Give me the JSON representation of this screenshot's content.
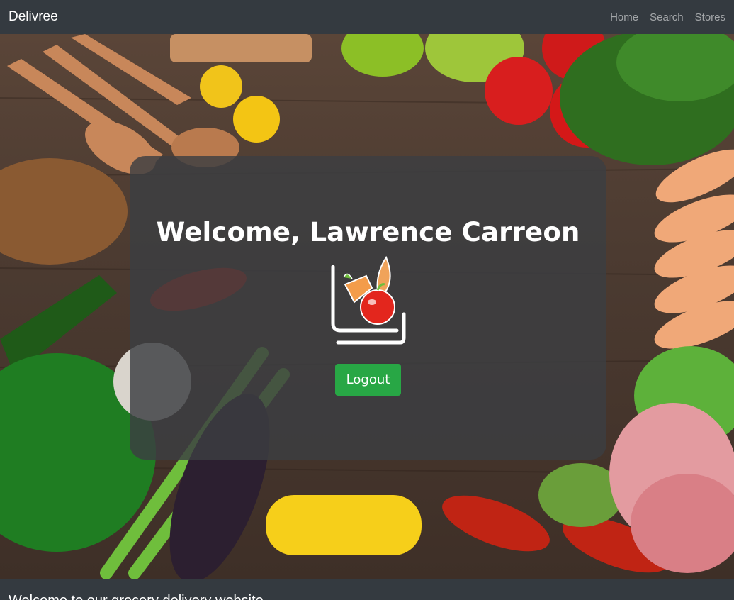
{
  "navbar": {
    "brand": "Delivree",
    "links": [
      {
        "label": "Home"
      },
      {
        "label": "Search"
      },
      {
        "label": "Stores"
      }
    ]
  },
  "hero": {
    "welcome_text": "Welcome, Lawrence Carreon",
    "logout_label": "Logout",
    "logo_icon": "grocery-basket-icon"
  },
  "footer": {
    "text": "Welcome to our grocery delivery website"
  },
  "colors": {
    "navbar_bg": "#343a40",
    "button_green": "#28a745",
    "panel_overlay": "rgba(60,62,66,0.82)"
  }
}
